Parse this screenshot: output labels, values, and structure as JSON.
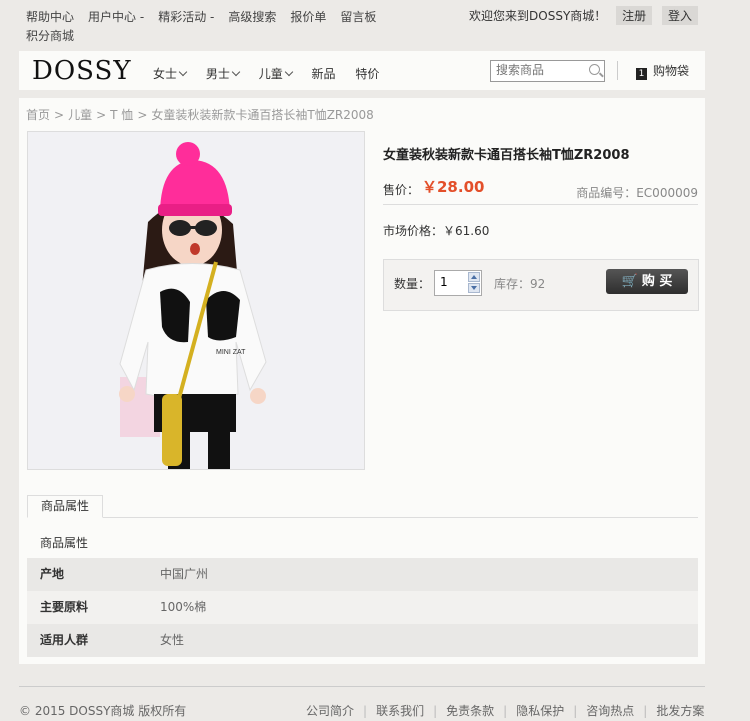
{
  "top": {
    "links": [
      "帮助中心",
      "用户中心",
      "精彩活动",
      "高级搜索",
      "报价单",
      "留言板",
      "积分商城"
    ],
    "welcome": "欢迎您来到DOSSY商城！",
    "register": "注册",
    "login": "登入"
  },
  "header": {
    "logo": "DOSSY",
    "nav": [
      {
        "label": "女士",
        "dropdown": true
      },
      {
        "label": "男士",
        "dropdown": true
      },
      {
        "label": "儿童",
        "dropdown": true
      },
      {
        "label": "新品",
        "dropdown": false
      },
      {
        "label": "特价",
        "dropdown": false
      }
    ],
    "search_placeholder": "搜索商品",
    "cart_count": "1",
    "cart_label": "购物袋"
  },
  "breadcrumb": [
    "首页",
    "儿童",
    "T 恤",
    "女童装秋装新款卡通百搭长袖T恤ZR2008"
  ],
  "product": {
    "title": "女童装秋装新款卡通百搭长袖T恤ZR2008",
    "price_label": "售价：",
    "price": "￥28.00",
    "sku": "商品编号：EC000009",
    "market_price": "市场价格：￥61.60",
    "qty_label": "数量：",
    "qty": "1",
    "stock": "库存：92",
    "buy_label": "购 买"
  },
  "tabs": {
    "active": "商品属性",
    "heading": "商品属性",
    "rows": [
      {
        "key": "产地",
        "value": "中国广州"
      },
      {
        "key": "主要原料",
        "value": "100%棉"
      },
      {
        "key": "适用人群",
        "value": "女性"
      }
    ]
  },
  "footer": {
    "copyright": "© 2015 DOSSY商城 版权所有",
    "links": [
      "公司简介",
      "联系我们",
      "免责条款",
      "隐私保护",
      "咨询热点",
      "批发方案"
    ]
  },
  "colors": {
    "price": "#e34f2a",
    "page_bg": "#eceae7",
    "panel_bg": "#fbfbf9"
  }
}
